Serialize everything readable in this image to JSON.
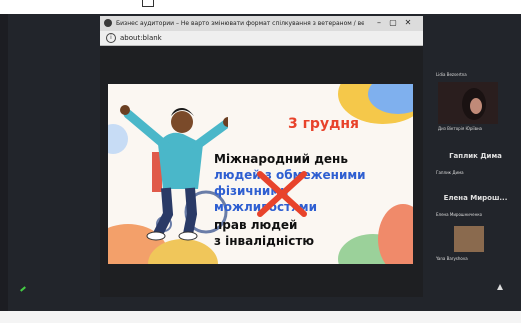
{
  "window": {
    "title": "Бизнес аудитории – Не варто змінювати формат спілкування з ветераном / ветеранкою виключно ч...",
    "url": "about:blank"
  },
  "slide": {
    "date": "3 грудня",
    "lines": [
      "Міжнародний день",
      "людей з обмеженими",
      "фізичними",
      "можливостями",
      "прав людей",
      "з інвалідністю"
    ]
  },
  "participants": [
    {
      "name": "Lidia Bezsertna"
    },
    {
      "name": "Диз Вiкторiя Юрiївна"
    },
    {
      "name": "Гаплик Дима"
    },
    {
      "name": "Гаплик Дима"
    },
    {
      "name": "Елена Мирош..."
    },
    {
      "name": "Елена Мирошниченко"
    },
    {
      "name": "Yana Baryshova"
    }
  ],
  "colors": {
    "accent_red": "#e8432b",
    "accent_blue": "#2f5fd1"
  }
}
